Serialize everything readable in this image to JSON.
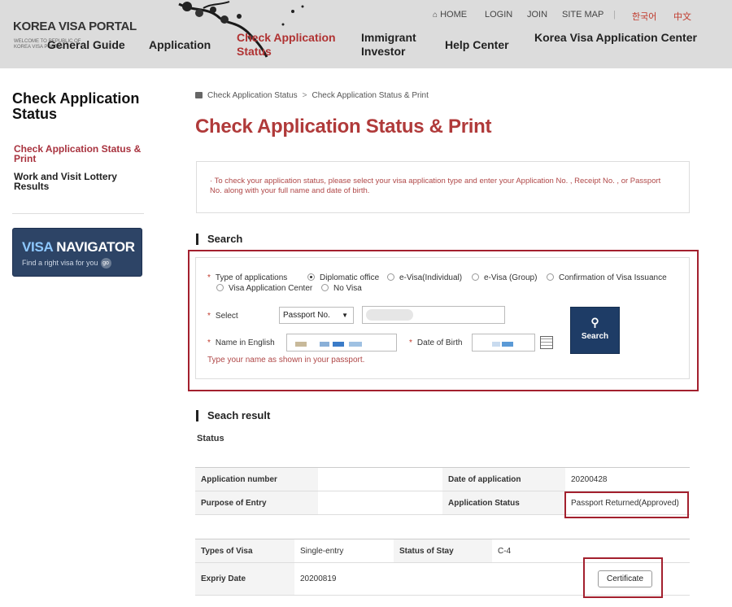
{
  "header": {
    "logo_title": "KOREA VISA PORTAL",
    "logo_sub": "WELCOME TO REPUBLIC OF KOREA VISA PORTAL",
    "util": {
      "home": "HOME",
      "login": "LOGIN",
      "join": "JOIN",
      "sitemap": "SITE MAP",
      "korean": "한국어",
      "chinese": "中文"
    },
    "nav": {
      "general_guide": "General Guide",
      "application": "Application",
      "check_application": "Check Application Status",
      "immigrant_investor": "Immigrant Investor",
      "help_center": "Help Center",
      "kvac": "Korea Visa Application Center"
    }
  },
  "sidebar": {
    "title": "Check Application Status",
    "links": [
      "Check Application Status & Print",
      "Work and Visit Lottery Results"
    ],
    "navigator": {
      "title_a": "VISA",
      "title_b": " NAVIGATOR",
      "sub": "Find a right visa for you",
      "go": "go"
    }
  },
  "breadcrumb": {
    "item1": "Check Application Status",
    "sep": ">",
    "item2": "Check Application Status & Print"
  },
  "page_title": "Check Application Status & Print",
  "info": "· To check your application status, please select your visa application type and enter your Application No. , Receipt No. , or Passport No. along with your full name and date of birth.",
  "search": {
    "section_title": "Search",
    "type_label": "Type of applications",
    "types": [
      "Diplomatic office",
      "e-Visa(Individual)",
      "e-Visa (Group)",
      "Confirmation of Visa Issuance",
      "Visa Application Center",
      "No Visa"
    ],
    "selected_type": "Diplomatic office",
    "select_label": "Select",
    "select_value": "Passport No.",
    "name_label": "Name in English",
    "dob_label": "Date of Birth",
    "button_label": "Search",
    "hint": "Type your name as shown in your passport."
  },
  "result": {
    "section_title": "Seach result",
    "status_label": "Status",
    "table1": {
      "app_number_label": "Application number",
      "app_number_value": "",
      "date_label": "Date of application",
      "date_value": "20200428",
      "purpose_label": "Purpose of Entry",
      "purpose_value": "",
      "status_label": "Application Status",
      "status_value": "Passport Returned(Approved)"
    },
    "table2": {
      "types_label": "Types of Visa",
      "types_value": "Single-entry",
      "stay_label": "Status of Stay",
      "stay_value": "C-4",
      "expiry_label": "Expriy Date",
      "expiry_value": "20200819",
      "certificate_label": "Certificate"
    }
  },
  "colors": {
    "accent_red": "#b03a3a",
    "highlight_border": "#a3202e",
    "navy": "#1e3c66"
  }
}
